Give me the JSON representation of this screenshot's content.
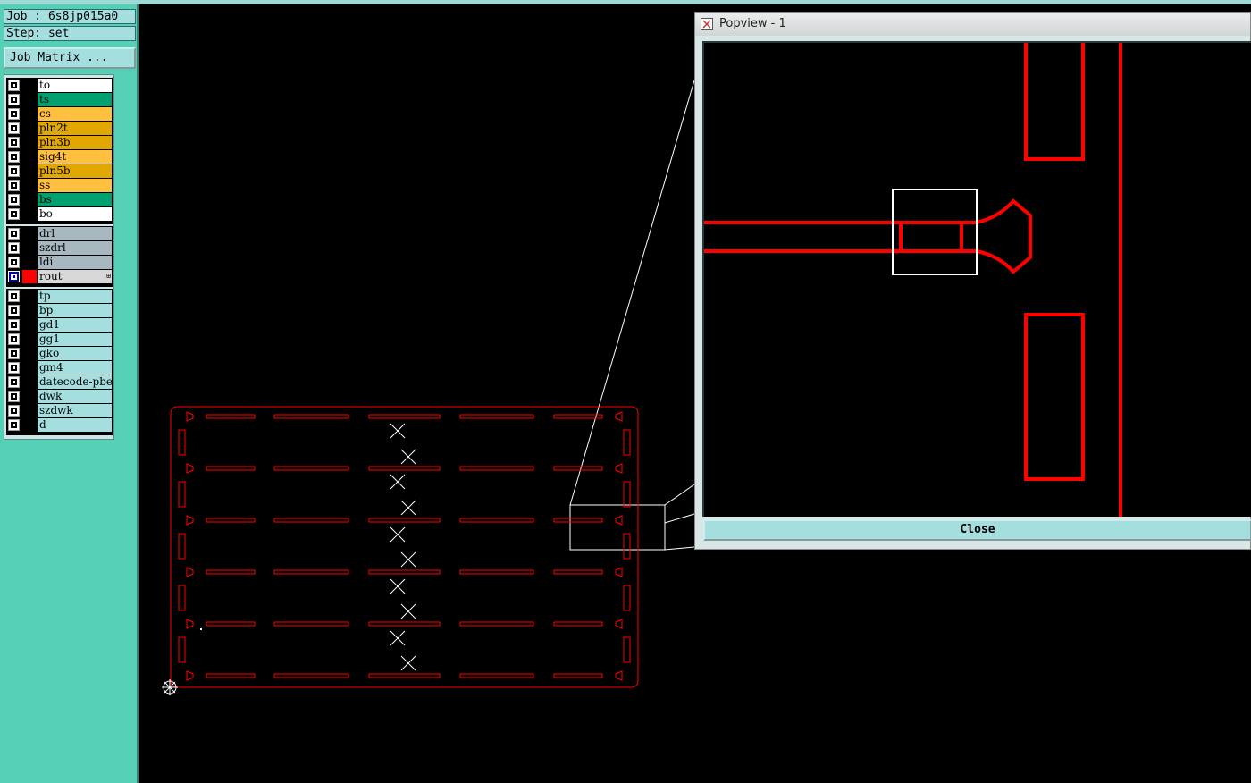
{
  "job_label": "Job : 6s8jp015a0",
  "step_label": "Step: set",
  "job_matrix_label": "Job Matrix ...",
  "layer_groups": {
    "board": [
      {
        "name": "to",
        "color": "#ffffff"
      },
      {
        "name": "ts",
        "color": "#00a070"
      },
      {
        "name": "cs",
        "color": "#ffc040"
      },
      {
        "name": "pln2t",
        "color": "#e0a800"
      },
      {
        "name": "pln3b",
        "color": "#e0a800"
      },
      {
        "name": "sig4t",
        "color": "#ffc040"
      },
      {
        "name": "pln5b",
        "color": "#e0a800"
      },
      {
        "name": "ss",
        "color": "#ffc040"
      },
      {
        "name": "bs",
        "color": "#00a070"
      },
      {
        "name": "bo",
        "color": "#ffffff"
      }
    ],
    "drill": [
      {
        "name": "drl",
        "color": "#a8b8c0"
      },
      {
        "name": "szdrl",
        "color": "#a8b8c0"
      },
      {
        "name": "ldi",
        "color": "#a8b8c0"
      },
      {
        "name": "rout",
        "color": "#d8d8d8",
        "active": true,
        "flag": "⊞"
      }
    ],
    "misc": [
      {
        "name": "tp",
        "color": "#a5dede"
      },
      {
        "name": "bp",
        "color": "#a5dede"
      },
      {
        "name": "gd1",
        "color": "#a5dede"
      },
      {
        "name": "gg1",
        "color": "#a5dede"
      },
      {
        "name": "gko",
        "color": "#a5dede"
      },
      {
        "name": "gm4",
        "color": "#a5dede"
      },
      {
        "name": "datecode-pbe",
        "color": "#a5dede"
      },
      {
        "name": "dwk",
        "color": "#a5dede"
      },
      {
        "name": "szdwk",
        "color": "#a5dede"
      },
      {
        "name": "d",
        "color": "#a5dede"
      }
    ]
  },
  "popview": {
    "title": "Popview - 1",
    "close_label": "Close"
  },
  "colors": {
    "rout_line": "#ff0000",
    "sidebar_bg": "#55d0b4",
    "panel_bg": "#a5dede",
    "canvas_bg": "#000000"
  }
}
